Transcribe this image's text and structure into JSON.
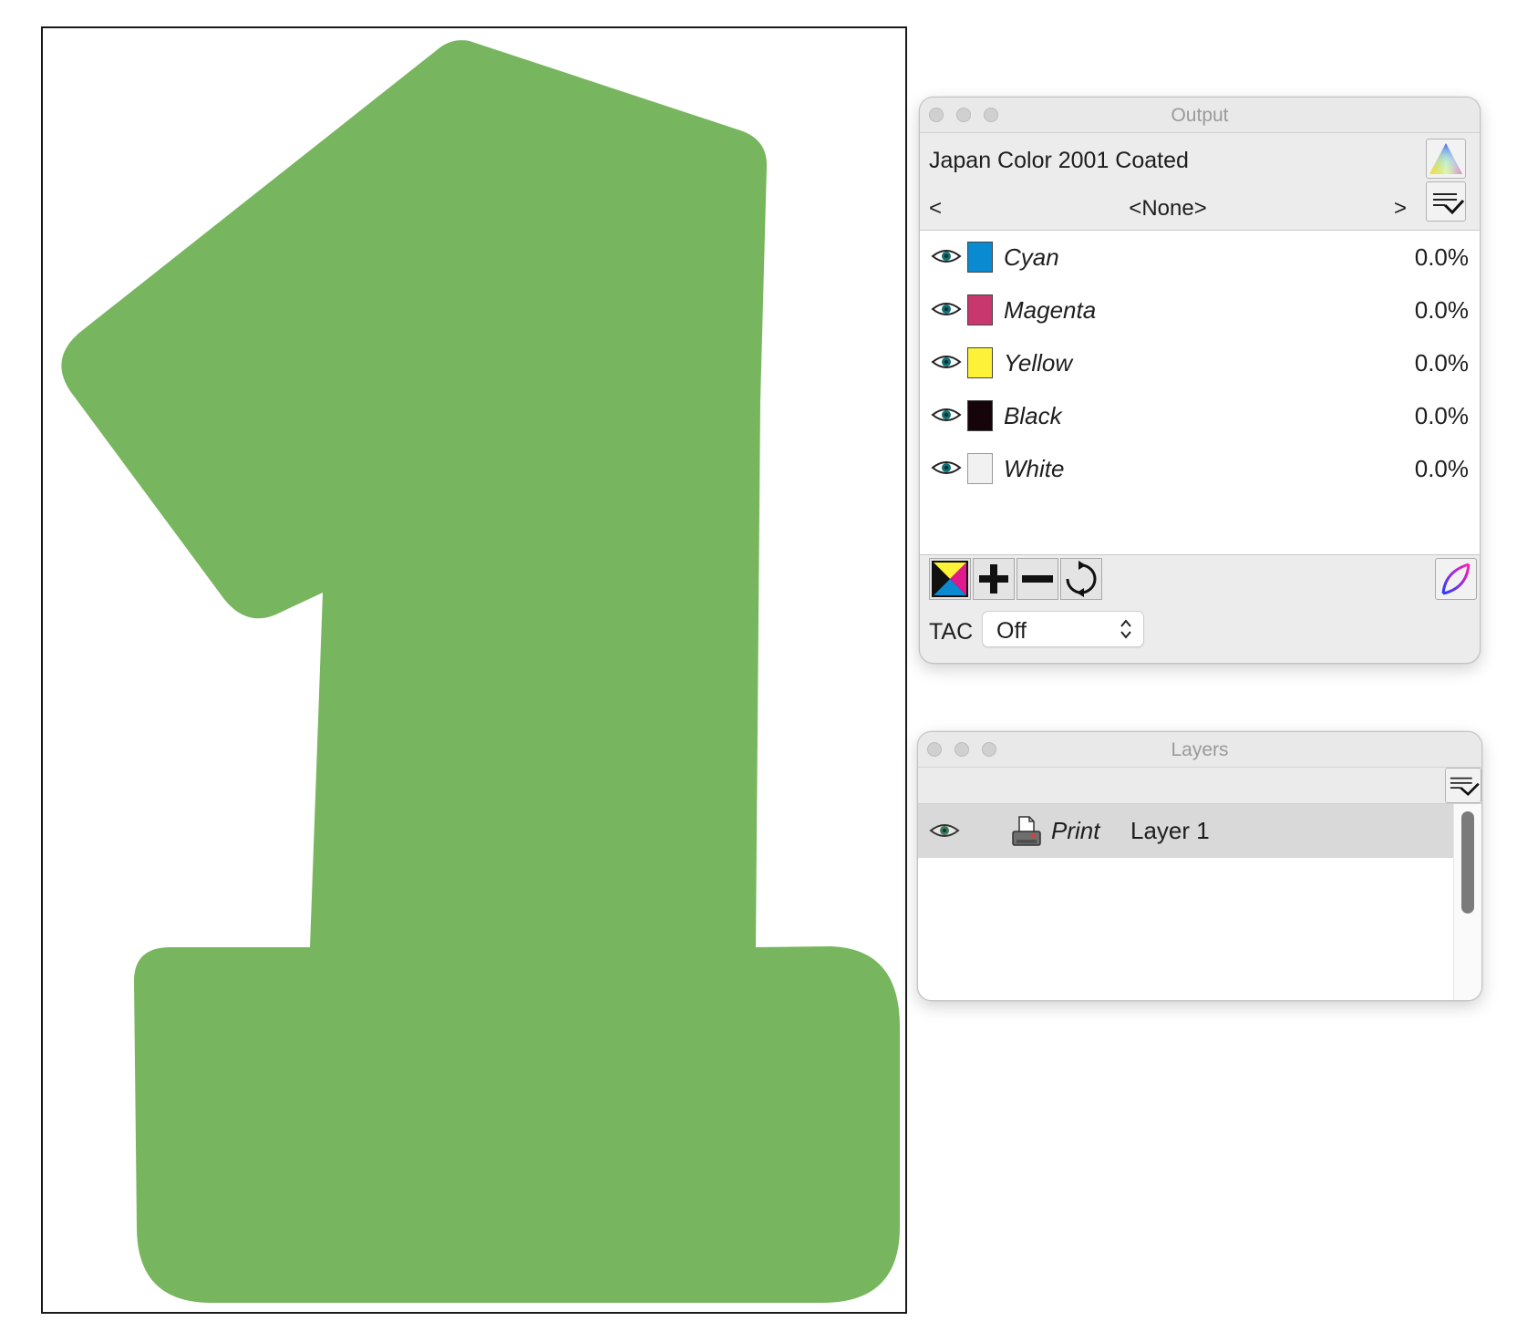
{
  "artboard": {
    "shape": "numeral-one",
    "fill_color": "#77b65e",
    "border_color": "#1a1a1a"
  },
  "output_panel": {
    "title": "Output",
    "profile": "Japan Color 2001 Coated",
    "nav": {
      "prev": "<",
      "label": "<None>",
      "next": ">"
    },
    "plates": [
      {
        "name": "Cyan",
        "value": "0.0%",
        "color": "#0a8ad1"
      },
      {
        "name": "Magenta",
        "value": "0.0%",
        "color": "#c8376e"
      },
      {
        "name": "Yellow",
        "value": "0.0%",
        "color": "#fdf238"
      },
      {
        "name": "Black",
        "value": "0.0%",
        "color": "#150409"
      },
      {
        "name": "White",
        "value": "0.0%",
        "color": "#f1f1f1"
      }
    ],
    "buttons": [
      "cmyk-plates-icon",
      "plus-icon",
      "minus-icon",
      "refresh-icon",
      "curve-icon"
    ],
    "tac": {
      "label": "TAC",
      "value": "Off"
    },
    "icons": {
      "gamut": "color-triangle-icon",
      "menu": "panel-menu-icon",
      "visibility": "eye-icon"
    }
  },
  "layers_panel": {
    "title": "Layers",
    "layers": [
      {
        "kind": "Print",
        "name": "Layer 1",
        "selected": true
      }
    ],
    "icons": {
      "menu": "panel-menu-icon",
      "layer_type": "printer-icon"
    }
  }
}
